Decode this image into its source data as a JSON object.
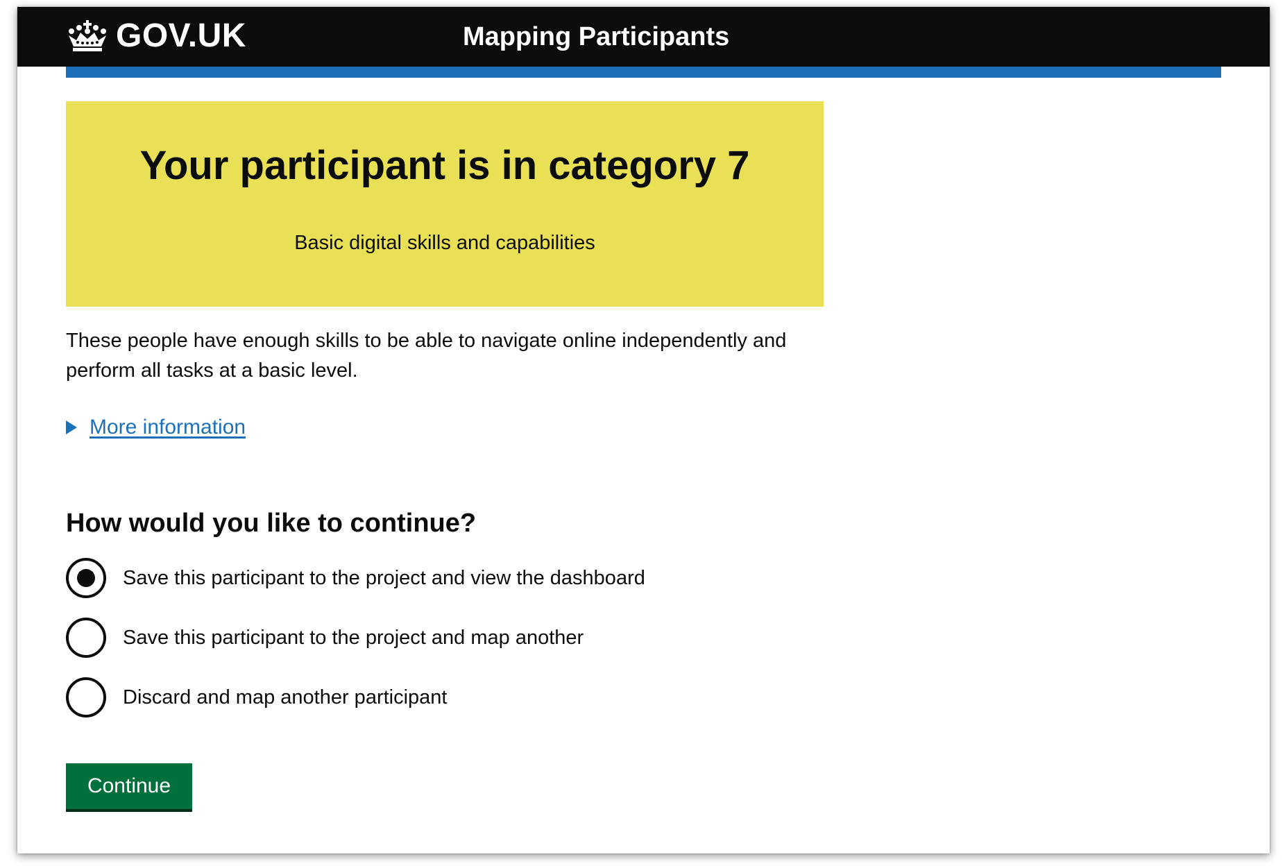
{
  "header": {
    "logo_text": "GOV.UK",
    "logo_icon": "crown-icon",
    "service_name": "Mapping Participants"
  },
  "result_panel": {
    "title": "Your participant is in category 7",
    "body": "Basic digital skills and capabilities"
  },
  "description": "These people have enough skills to be able to navigate online independently and perform all tasks at a basic level.",
  "details": {
    "summary": "More information",
    "icon": "triangle-right-icon"
  },
  "question": {
    "heading": "How would you like to continue?",
    "options": [
      {
        "label": "Save this participant to the project and view the dashboard",
        "checked": true
      },
      {
        "label": "Save this participant to the project and map another",
        "checked": false
      },
      {
        "label": "Discard and map another participant",
        "checked": false
      }
    ]
  },
  "continue_button": {
    "label": "Continue"
  },
  "colors": {
    "header_background": "#0b0c0c",
    "header_accent_bar": "#1d70b8",
    "panel_background": "#e9e056",
    "link": "#1d70b8",
    "button_background": "#00703c"
  }
}
